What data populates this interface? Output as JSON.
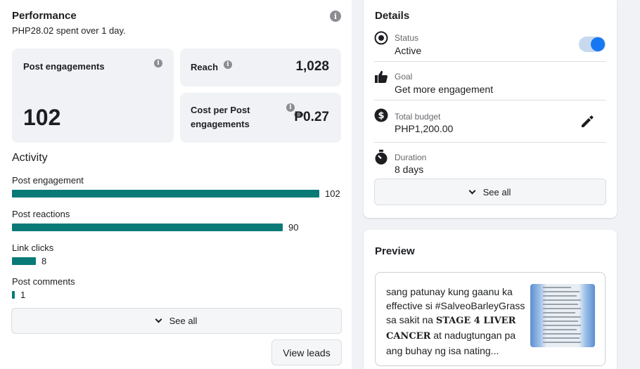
{
  "performance": {
    "title": "Performance",
    "subtitle_amount": "PHP28.02",
    "subtitle_mid": " spent over ",
    "subtitle_days": "1 day",
    "subtitle_end": ".",
    "post_engagements_label": "Post engagements",
    "post_engagements_value": "102",
    "reach_label": "Reach",
    "reach_value": "1,028",
    "cost_label_line1": "Cost per Post",
    "cost_label_line2": "engagements",
    "cost_value": "₱0.27",
    "activity_title": "Activity",
    "activity": [
      {
        "label": "Post engagement",
        "value": "102",
        "fraction": 1.0
      },
      {
        "label": "Post reactions",
        "value": "90",
        "fraction": 0.882
      },
      {
        "label": "Link clicks",
        "value": "8",
        "fraction": 0.078
      },
      {
        "label": "Post comments",
        "value": "1",
        "fraction": 0.01
      }
    ],
    "see_all_label": "See all",
    "view_leads_label": "View leads"
  },
  "details": {
    "title": "Details",
    "status_label": "Status",
    "status_value": "Active",
    "status_on": true,
    "goal_label": "Goal",
    "goal_value": "Get more engagement",
    "budget_label": "Total budget",
    "budget_value": "PHP1,200.00",
    "duration_label": "Duration",
    "duration_value": "8 days",
    "see_all_label": "See all"
  },
  "preview": {
    "title": "Preview",
    "text_part1": "sang patunay kung gaanu ka effective si #SalveoBarleyGrass sa sakit na ",
    "text_strong": "STAGE 4 LIVER CANCER",
    "text_part2": " at nadugtungan pa ang buhay ng isa nating..."
  },
  "colors": {
    "bar": "#0a7a77",
    "accent": "#1877f2"
  }
}
